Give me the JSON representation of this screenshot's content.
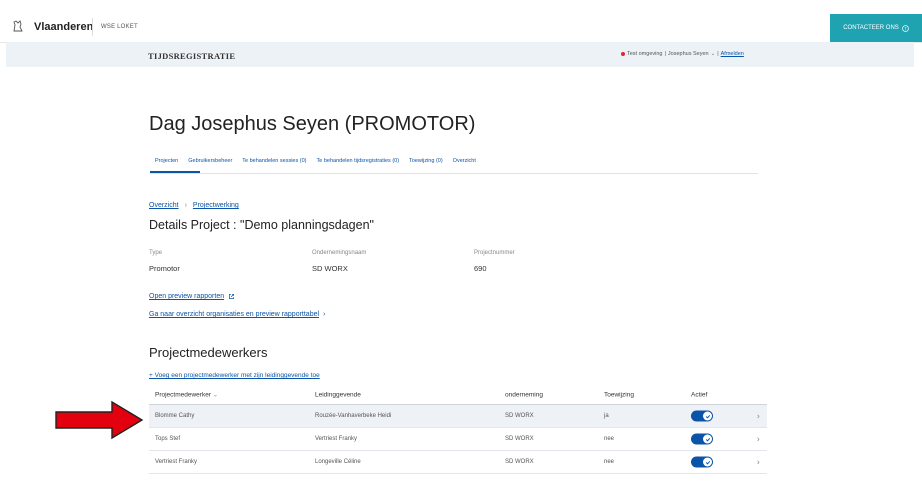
{
  "global_header": {
    "brand": "Vlaanderen",
    "sub_brand": "WSE LOKET",
    "contact_label": "CONTACTEER ONS",
    "contact_icon": "question-icon"
  },
  "app_header": {
    "title": "TIJDSREGISTRATIE",
    "environment": "Test omgeving",
    "user": "Josephus Seyen",
    "logout": "Afmelden"
  },
  "page": {
    "title": "Dag Josephus Seyen (PROMOTOR)"
  },
  "tabs": [
    {
      "label": "Projecten",
      "active": true
    },
    {
      "label": "Gebruikersbeheer",
      "active": false
    },
    {
      "label": "Te behandelen sessies (0)",
      "active": false
    },
    {
      "label": "Te behandelen tijdsregistraties (0)",
      "active": false
    },
    {
      "label": "Toewijzing (0)",
      "active": false
    },
    {
      "label": "Overzicht",
      "active": false
    }
  ],
  "breadcrumb": {
    "items": [
      "Overzicht",
      "Projectwerking"
    ],
    "separator": "›"
  },
  "details": {
    "title": "Details Project : \"Demo planningsdagen\"",
    "fields": [
      {
        "label": "Type",
        "value": "Promotor"
      },
      {
        "label": "Ondernemingsnaam",
        "value": "SD WORX"
      },
      {
        "label": "Projectnummer",
        "value": "690"
      }
    ]
  },
  "links": {
    "preview_reports": "Open preview rapporten",
    "overview_orgs": "Ga naar overzicht organisaties en preview rapporttabel"
  },
  "project_members": {
    "title": "Projectmedewerkers",
    "add_link": "+ Voeg een projectmedewerker met zijn leidinggevende toe",
    "columns": [
      "Projectmedewerker",
      "Leidinggevende",
      "onderneming",
      "Toewijzing",
      "Actief"
    ],
    "rows": [
      {
        "medewerker": "Blomme Cathy",
        "leidinggevende": "Rouzée-Vanhaverbeke Heidi",
        "onderneming": "SD WORX",
        "toewijzing": "ja",
        "actief": true,
        "highlight": true
      },
      {
        "medewerker": "Tops Stef",
        "leidinggevende": "Vertriest Franky",
        "onderneming": "SD WORX",
        "toewijzing": "nee",
        "actief": true,
        "highlight": false
      },
      {
        "medewerker": "Vertriest Franky",
        "leidinggevende": "Longeville Céline",
        "onderneming": "SD WORX",
        "toewijzing": "nee",
        "actief": true,
        "highlight": false
      }
    ]
  },
  "colors": {
    "primary": "#0b54a8",
    "contact_bg": "#1fa3b1",
    "appbar_bg": "#edf2f7",
    "annotation_arrow": "#e3000f",
    "env_dot": "#e0262e"
  }
}
